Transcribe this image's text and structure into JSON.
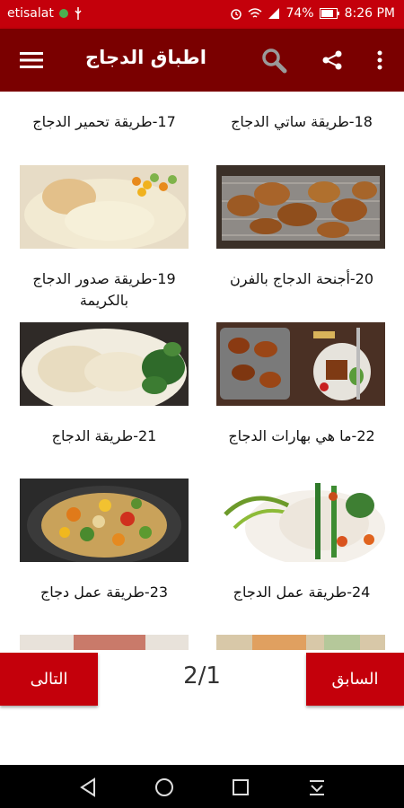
{
  "status_bar": {
    "carrier": "etisalat",
    "battery": "74%",
    "time": "8:26 PM"
  },
  "app_bar": {
    "title": "اطباق الدجاج",
    "menu_icon": "hamburger-menu-icon",
    "search_icon": "search-icon",
    "share_icon": "share-icon",
    "more_icon": "more-vert-icon",
    "color": "#7a0000"
  },
  "recipes": [
    {
      "label": "18-طريقة ساتي الدجاج"
    },
    {
      "label": "17-طريقة تحمير الدجاج"
    },
    {
      "label": "20-أجنحة الدجاج بالفرن"
    },
    {
      "label": "19-طريقة صدور الدجاج بالكريمة"
    },
    {
      "label": "22-ما هي بهارات الدجاج"
    },
    {
      "label": "21-طريقة الدجاج"
    },
    {
      "label": "24-طريقة عمل الدجاج"
    },
    {
      "label": "23-طريقة عمل دجاج"
    }
  ],
  "pagination": {
    "prev_label": "السابق",
    "next_label": "التالى",
    "page_indicator": "2/1",
    "button_color": "#c4000b"
  },
  "nav_bar": {
    "back_icon": "back-icon",
    "home_icon": "home-icon",
    "recents_icon": "recents-icon",
    "notifications_icon": "notification-pulldown-icon"
  }
}
